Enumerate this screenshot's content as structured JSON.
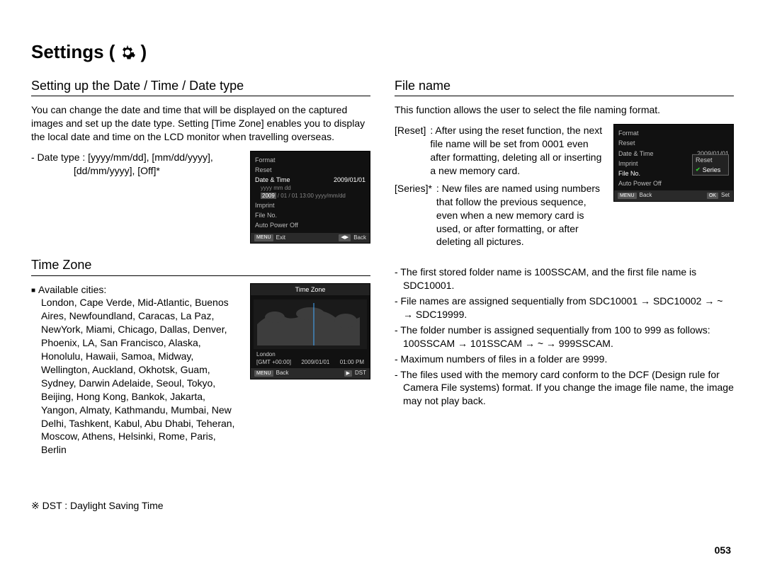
{
  "title": "Settings (",
  "title_close": ")",
  "page_number": "053",
  "left": {
    "section1_heading": "Setting up the Date / Time / Date type",
    "section1_body": "You can change the date and time that will be displayed on the captured images and set up the date type. Setting [Time Zone] enables you to display the local date and time on the LCD monitor when travelling overseas.",
    "date_type_line1": "- Date type : [yyyy/mm/dd], [mm/dd/yyyy],",
    "date_type_line2": "[dd/mm/yyyy], [Off]*",
    "section2_heading": "Time Zone",
    "cities_label": "Available cities:",
    "cities_body": "London, Cape Verde, Mid-Atlantic, Buenos Aires, Newfoundland, Caracas, La Paz, NewYork, Miami, Chicago, Dallas, Denver, Phoenix, LA, San Francisco, Alaska, Honolulu, Hawaii, Samoa, Midway, Wellington, Auckland, Okhotsk, Guam, Sydney, Darwin Adelaide, Seoul, Tokyo, Beijing, Hong Kong, Bankok, Jakarta, Yangon, Almaty, Kathmandu, Mumbai, New Delhi, Tashkent, Kabul, Abu Dhabi, Teheran, Moscow, Athens, Helsinki, Rome, Paris, Berlin",
    "dst_note": "※ DST : Daylight Saving Time",
    "sc_dt": {
      "items": [
        "Format",
        "Reset",
        "Date & Time",
        "Imprint",
        "File No.",
        "Auto Power Off"
      ],
      "date_value": "2009/01/01",
      "sub1": "yyyy mm dd",
      "sub2_a": "2009",
      "sub2_b": "/ 01 / 01   13:00   yyyy/mm/dd",
      "footer_left_key": "MENU",
      "footer_left": "Exit",
      "footer_right_key": "◀▶",
      "footer_right": "Back"
    },
    "sc_tz": {
      "header": "Time Zone",
      "city": "London",
      "info_left": "[GMT +00:00]",
      "info_mid": "2009/01/01",
      "info_right": "01:00 PM",
      "footer_left_key": "MENU",
      "footer_left": "Back",
      "footer_right_key": "▶",
      "footer_right": "DST"
    }
  },
  "right": {
    "section_heading": "File name",
    "intro": "This function allows the user to select the file naming format.",
    "reset_term": "[Reset]",
    "reset_def": ": After using the reset function, the next file name will be set from 0001 even after formatting, deleting all or inserting a new memory card.",
    "series_term": "[Series]*",
    "series_def": ": New files are named using numbers that follow the previous sequence, even when a new memory card is used, or after formatting, or after deleting all pictures.",
    "bullets": [
      "- The first stored folder name is 100SSCAM, and the first file name is SDC10001.",
      "- File names are assigned sequentially from SDC10001 → SDC10002 → ~ → SDC19999.",
      "- The folder number is assigned sequentially from 100 to 999 as follows: 100SSCAM → 101SSCAM → ~ → 999SSCAM.",
      "- Maximum numbers of files in a folder are 9999.",
      "- The files used with the memory card conform to the DCF (Design rule for Camera File systems) format. If you change the image file name, the image may not play back."
    ],
    "sc_fn": {
      "items": [
        "Format",
        "Reset",
        "Date & Time",
        "Imprint",
        "File No.",
        "Auto Power Off"
      ],
      "date_value": "2009/01/01",
      "popup_reset": "Reset",
      "popup_series": "Series",
      "footer_left_key": "MENU",
      "footer_left": "Back",
      "footer_right_key": "OK",
      "footer_right": "Set"
    }
  }
}
